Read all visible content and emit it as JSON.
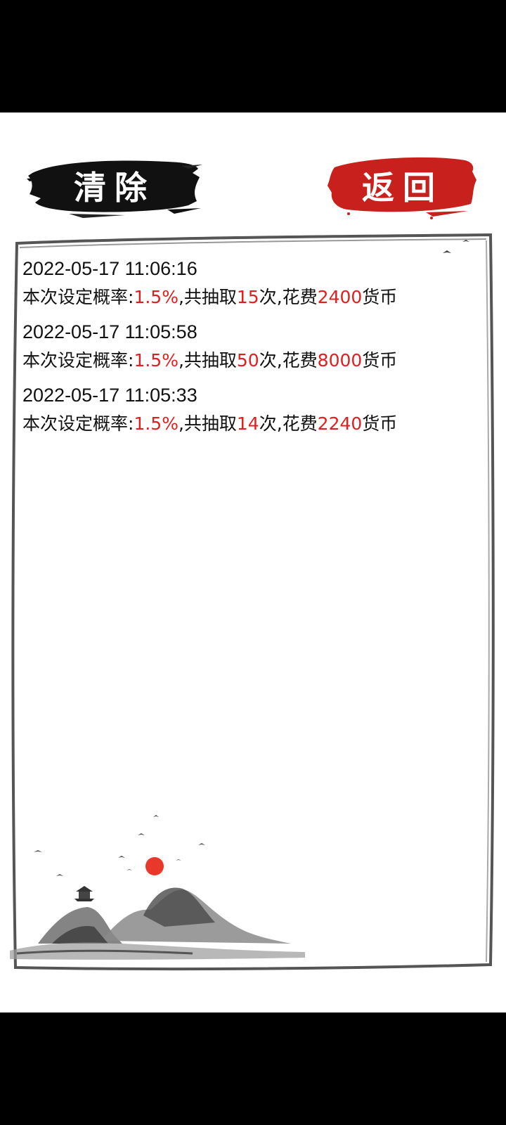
{
  "header": {
    "clear_label": "清除",
    "back_label": "返回"
  },
  "records": [
    {
      "time": "2022-05-17 11:06:16",
      "prefix": "本次设定概率:",
      "rate": "1.5%",
      "draw_prefix": ",共抽取",
      "count": "15",
      "draw_suffix": "次,花费",
      "cost": "2400",
      "unit": "货币"
    },
    {
      "time": "2022-05-17 11:05:58",
      "prefix": "本次设定概率:",
      "rate": "1.5%",
      "draw_prefix": ",共抽取",
      "count": "50",
      "draw_suffix": "次,花费",
      "cost": "8000",
      "unit": "货币"
    },
    {
      "time": "2022-05-17 11:05:33",
      "prefix": "本次设定概率:",
      "rate": "1.5%",
      "draw_prefix": ",共抽取",
      "count": "14",
      "draw_suffix": "次,花费",
      "cost": "2240",
      "unit": "货币"
    }
  ],
  "colors": {
    "highlight": "#e02020",
    "clear_button_ink": "#111111",
    "back_button_ink": "#c8201c",
    "sun": "#e8382a"
  },
  "icons": [
    "ink-brush-stroke",
    "ink-mountain-landscape",
    "red-sun",
    "bird-silhouette",
    "pavilion"
  ]
}
